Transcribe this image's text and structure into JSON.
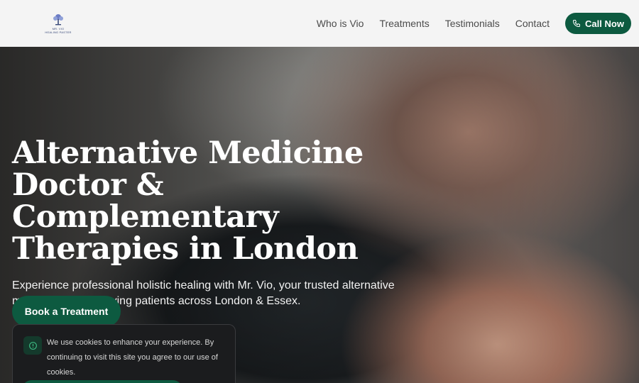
{
  "header": {
    "logo_line1": "MR. VIO",
    "logo_line2": "HEALING PASTER",
    "nav": [
      {
        "label": "Who is Vio"
      },
      {
        "label": "Treatments"
      },
      {
        "label": "Testimonials"
      },
      {
        "label": "Contact"
      }
    ],
    "call_label": "Call Now"
  },
  "hero": {
    "title": "Alternative Medicine Doctor & Complementary Therapies in London",
    "subtitle": "Experience professional holistic healing with Mr. Vio, your trusted alternative medicine expert serving patients across London & Essex.",
    "cta_label": "Book a Treatment"
  },
  "cookie": {
    "text": "We use cookies to enhance your experience. By continuing to visit this site you agree to our use of cookies.",
    "icon": "info-icon"
  },
  "colors": {
    "brand_green": "#0d5a40",
    "header_bg": "#f4f4f4"
  }
}
